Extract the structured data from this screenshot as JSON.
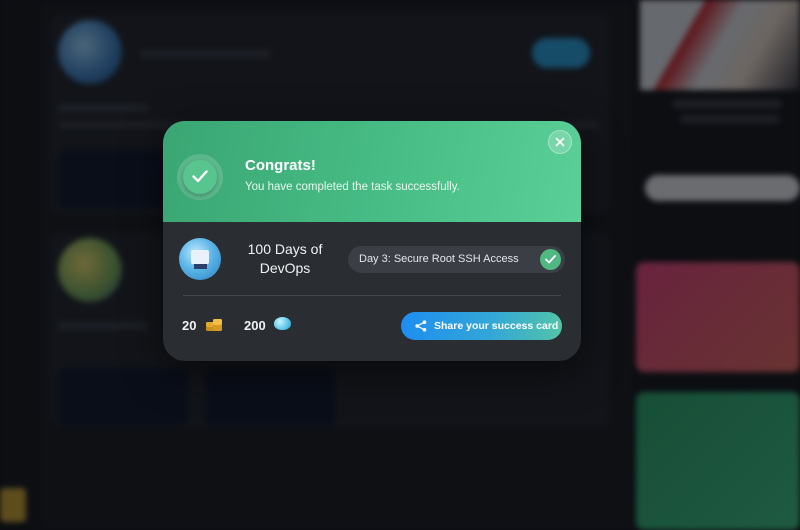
{
  "modal": {
    "title": "Congrats!",
    "message": "You have completed the task successfully.",
    "course_name": "100 Days of DevOps",
    "task_label": "Day 3: Secure Root SSH Access",
    "coins": "20",
    "gems": "200",
    "share_label": "Share your success card",
    "icons": {
      "success": "checkmark-icon",
      "close": "close-icon",
      "task_done": "checkmark-icon",
      "coins": "coins-icon",
      "gems": "gem-icon",
      "share": "share-icon"
    }
  },
  "colors": {
    "header_green": "#48bd86",
    "modal_bg": "#2a2d31",
    "share_gradient_start": "#1e8ef0",
    "share_gradient_end": "#52c4a8"
  }
}
